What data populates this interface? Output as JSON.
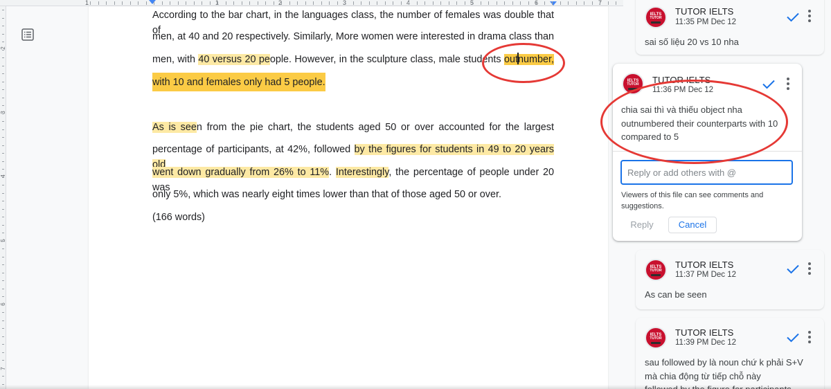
{
  "ruler": {
    "numbers": [
      "1",
      "1",
      "2",
      "3",
      "4",
      "5",
      "6",
      "7"
    ],
    "vertical_numbers": [
      "2",
      "3",
      "4",
      "5",
      "6",
      "7"
    ]
  },
  "document": {
    "paragraph1": {
      "line1": "According to the bar chart, in the languages class, the number of females was double that of",
      "line2": "men, at 40 and 20 respectively. Similarly, More women were interested in drama class than",
      "line3_a": "men, with ",
      "line3_hl": "40 versus 20 pe",
      "line3_b": "ople. However, in the sculpture class, male students ",
      "line3_c1": "out",
      "line3_c2": "number,",
      "line4": "with 10 and females only had  5 people."
    },
    "paragraph2": {
      "line1_a": "As is see",
      "line1_b": "n from the pie chart, the students aged 50 or over accounted for the largest",
      "line2_a": "percentage of participants, at 42%, followed ",
      "line2_hl": "by the figures for students in 49 to 20 years old",
      "line3_hl": "went down gradually from 26% to 11%",
      "line3_b": ". ",
      "line3_hl2": "Interestingly",
      "line3_c": ", the percentage of people under 20 was",
      "line4": "only 5%, which was nearly eight times lower than that of those aged 50 or over."
    },
    "word_count": "(166 words)"
  },
  "comments": [
    {
      "author": "TUTOR IELTS",
      "time": "11:35 PM Dec 12",
      "text": "sai số liệu 20 vs 10 nha"
    },
    {
      "author": "TUTOR IELTS",
      "time": "11:36 PM Dec 12",
      "text_line1": "chia sai thì và thiếu object nha",
      "text_line2": "outnumbered their counterparts with 10",
      "text_line3": "compared to 5",
      "reply_placeholder": "Reply or add others with @",
      "viewers_note": "Viewers of this file can see comments and suggestions.",
      "reply_label": "Reply",
      "cancel_label": "Cancel"
    },
    {
      "author": "TUTOR IELTS",
      "time": "11:37 PM Dec 12",
      "text": "As can be seen"
    },
    {
      "author": "TUTOR IELTS",
      "time": "11:39 PM Dec 12",
      "text_line1": "sau followed by là noun chứ k phải S+V",
      "text_line2": "mà chia động từ tiếp chỗ này",
      "text_line3": "followed by the figure for participants"
    }
  ],
  "avatar": {
    "line1": "IELTS",
    "line2": "TUTOR"
  },
  "colors": {
    "highlight_light": "#fde9a4",
    "highlight_strong": "#fbcb45",
    "annotation_red": "#e53935",
    "accent_blue": "#1a73e8"
  }
}
